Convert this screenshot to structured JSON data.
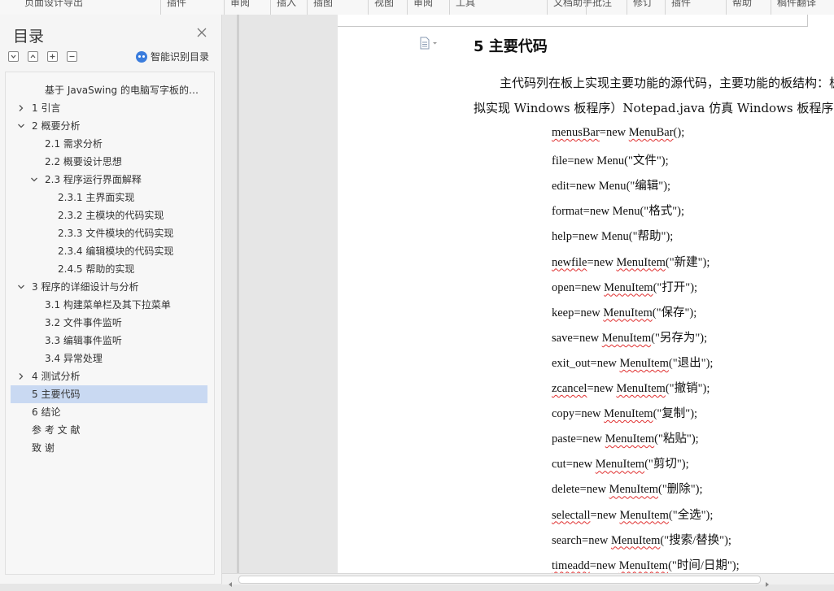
{
  "toolbar": {
    "items": [
      "页面设计导出",
      "插件",
      "审阅",
      "插入",
      "插图",
      "视图",
      "审阅",
      "工具",
      "文档助手",
      "批注",
      "修订",
      "插件",
      "帮助",
      "稿件翻译"
    ]
  },
  "sidebar": {
    "title": "目录",
    "smart_toc_label": "智能识别目录",
    "items": [
      {
        "text": "基于 JavaSwing 的电脑写字板的设计与实现",
        "level": 1,
        "chevron": "none"
      },
      {
        "text": "1  引言",
        "level": 0,
        "chevron": "right"
      },
      {
        "text": "2  概要分析",
        "level": 0,
        "chevron": "down"
      },
      {
        "text": "2.1  需求分析",
        "level": 1,
        "chevron": "none"
      },
      {
        "text": "2.2  概要设计思想",
        "level": 1,
        "chevron": "none"
      },
      {
        "text": "2.3  程序运行界面解释",
        "level": 1,
        "chevron": "down"
      },
      {
        "text": "2.3.1  主界面实现",
        "level": 2,
        "chevron": "none"
      },
      {
        "text": "2.3.2  主模块的代码实现",
        "level": 2,
        "chevron": "none"
      },
      {
        "text": "2.3.3  文件模块的代码实现",
        "level": 2,
        "chevron": "none"
      },
      {
        "text": "2.3.4  编辑模块的代码实现",
        "level": 2,
        "chevron": "none"
      },
      {
        "text": "2.4.5  帮助的实现",
        "level": 2,
        "chevron": "none"
      },
      {
        "text": "3  程序的详细设计与分析",
        "level": 0,
        "chevron": "down"
      },
      {
        "text": "3.1  构建菜单栏及其下拉菜单",
        "level": 1,
        "chevron": "none"
      },
      {
        "text": "3.2  文件事件监听",
        "level": 1,
        "chevron": "none"
      },
      {
        "text": "3.3  编辑事件监听",
        "level": 1,
        "chevron": "none"
      },
      {
        "text": "3.4  异常处理",
        "level": 1,
        "chevron": "none"
      },
      {
        "text": "4  测试分析",
        "level": 0,
        "chevron": "right"
      },
      {
        "text": "5  主要代码",
        "level": 0,
        "chevron": "none",
        "active": true
      },
      {
        "text": "6  结论",
        "level": 0,
        "chevron": "none"
      },
      {
        "text": "参 考 文 献",
        "level": 0,
        "chevron": "none"
      },
      {
        "text": "致    谢",
        "level": 0,
        "chevron": "none"
      }
    ]
  },
  "document": {
    "heading": "5  主要代码",
    "paragraph_line1": "主代码列在板上实现主要功能的源代码，主要功能的板结构：板编辑器（模",
    "paragraph_line2": "拟实现 Windows 板程序）Notepad.java 仿真 Windows 板程序，准备一块板。",
    "code_lines": [
      "menusBar=new MenuBar();",
      "file=new Menu(\"文件\");",
      "edit=new Menu(\"编辑\");",
      "format=new Menu(\"格式\");",
      "help=new Menu(\"帮助\");",
      "newfile=new MenuItem(\"新建\");",
      "open=new MenuItem(\"打开\");",
      "keep=new MenuItem(\"保存\");",
      "save=new MenuItem(\"另存为\");",
      "exit_out=new MenuItem(\"退出\");",
      "zcancel=new MenuItem(\"撤销\");",
      "copy=new MenuItem(\"复制\");",
      "paste=new MenuItem(\"粘贴\");",
      "cut=new MenuItem(\"剪切\");",
      "delete=new MenuItem(\"删除\");",
      "selectall=new MenuItem(\"全选\");",
      "search=new MenuItem(\"搜索/替换\");",
      "timeadd=new MenuItem(\"时间/日期\");"
    ]
  },
  "colors": {
    "active_toc": "#c9d9f2",
    "accent": "#3b7ddd",
    "spell_underline": "#e03030"
  }
}
